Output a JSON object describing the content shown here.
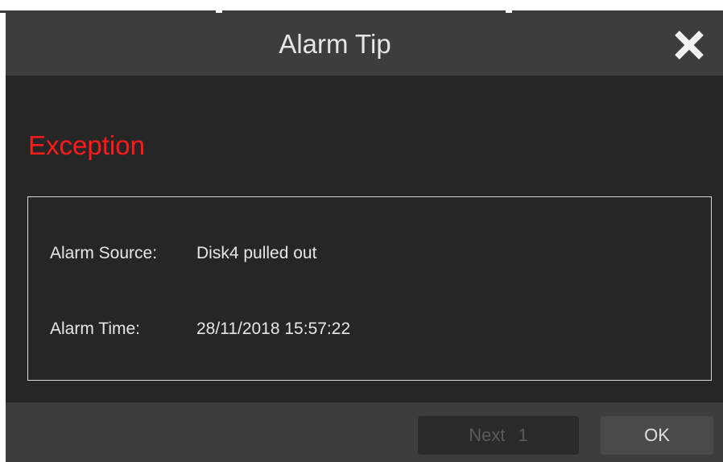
{
  "dialog": {
    "title": "Alarm Tip",
    "close_icon": "close-icon",
    "heading": "Exception",
    "heading_color": "#ff1a1a",
    "fields": {
      "source_label": "Alarm Source:",
      "source_value": "Disk4 pulled out",
      "time_label": "Alarm Time:",
      "time_value": "28/11/2018 15:57:22"
    },
    "buttons": {
      "next_label": "Next 1",
      "ok_label": "OK"
    }
  }
}
